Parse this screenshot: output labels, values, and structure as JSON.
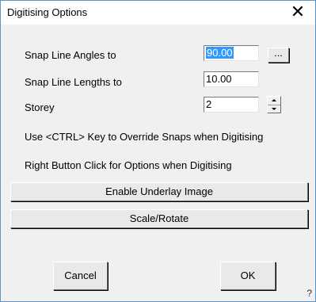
{
  "window": {
    "title": "Digitising Options",
    "close_glyph": "✕"
  },
  "fields": {
    "snap_angles_label": "Snap Line Angles to",
    "snap_angles_value": "90.00",
    "snap_angles_browse": "...",
    "snap_lengths_label": "Snap Line Lengths to",
    "snap_lengths_value": "10.00",
    "storey_label": "Storey",
    "storey_value": "2"
  },
  "info": {
    "ctrl_hint": "Use <CTRL> Key to Override Snaps when Digitising",
    "right_click_hint": "Right Button Click for Options when Digitising"
  },
  "buttons": {
    "underlay": "Enable Underlay Image",
    "scale_rotate": "Scale/Rotate",
    "cancel": "Cancel",
    "ok": "OK",
    "help": "?"
  }
}
